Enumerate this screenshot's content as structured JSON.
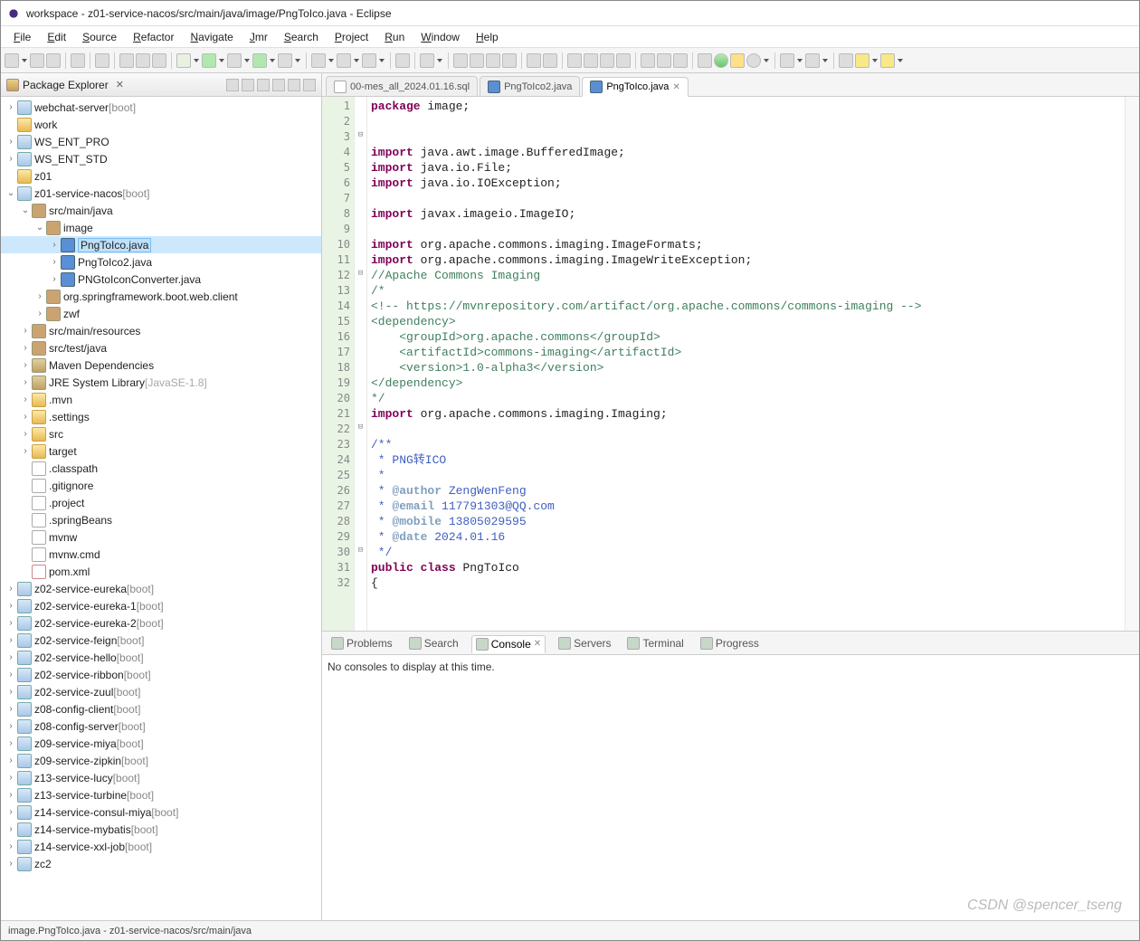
{
  "window": {
    "title": "workspace - z01-service-nacos/src/main/java/image/PngToIco.java - Eclipse"
  },
  "menu": [
    "File",
    "Edit",
    "Source",
    "Refactor",
    "Navigate",
    "Jmr",
    "Search",
    "Project",
    "Run",
    "Window",
    "Help"
  ],
  "package_explorer": {
    "title": "Package Explorer",
    "tree": [
      {
        "d": 1,
        "t": ">",
        "ic": "proj",
        "l": "webchat-server",
        "suf": "[boot]"
      },
      {
        "d": 1,
        "t": "",
        "ic": "folder",
        "l": "work"
      },
      {
        "d": 1,
        "t": ">",
        "ic": "proj",
        "l": "WS_ENT_PRO"
      },
      {
        "d": 1,
        "t": ">",
        "ic": "proj",
        "l": "WS_ENT_STD"
      },
      {
        "d": 1,
        "t": "",
        "ic": "folder",
        "l": "z01"
      },
      {
        "d": 1,
        "t": "v",
        "ic": "proj",
        "l": "z01-service-nacos",
        "suf": "[boot]"
      },
      {
        "d": 2,
        "t": "v",
        "ic": "pkg",
        "l": "src/main/java"
      },
      {
        "d": 3,
        "t": "v",
        "ic": "pkg",
        "l": "image"
      },
      {
        "d": 4,
        "t": ">",
        "ic": "java",
        "l": "PngToIco.java",
        "sel": true
      },
      {
        "d": 4,
        "t": ">",
        "ic": "java",
        "l": "PngToIco2.java"
      },
      {
        "d": 4,
        "t": ">",
        "ic": "java",
        "l": "PNGtoIconConverter.java"
      },
      {
        "d": 3,
        "t": ">",
        "ic": "pkg",
        "l": "org.springframework.boot.web.client"
      },
      {
        "d": 3,
        "t": ">",
        "ic": "pkg",
        "l": "zwf"
      },
      {
        "d": 2,
        "t": ">",
        "ic": "pkg",
        "l": "src/main/resources"
      },
      {
        "d": 2,
        "t": ">",
        "ic": "pkg",
        "l": "src/test/java"
      },
      {
        "d": 2,
        "t": ">",
        "ic": "jar",
        "l": "Maven Dependencies"
      },
      {
        "d": 2,
        "t": ">",
        "ic": "jar",
        "l": "JRE System Library",
        "suf": "[JavaSE-1.8]",
        "jre": true
      },
      {
        "d": 2,
        "t": ">",
        "ic": "folder",
        "l": ".mvn"
      },
      {
        "d": 2,
        "t": ">",
        "ic": "folder",
        "l": ".settings"
      },
      {
        "d": 2,
        "t": ">",
        "ic": "folder",
        "l": "src"
      },
      {
        "d": 2,
        "t": ">",
        "ic": "folder",
        "l": "target"
      },
      {
        "d": 2,
        "t": "",
        "ic": "file",
        "l": ".classpath"
      },
      {
        "d": 2,
        "t": "",
        "ic": "file",
        "l": ".gitignore"
      },
      {
        "d": 2,
        "t": "",
        "ic": "file",
        "l": ".project"
      },
      {
        "d": 2,
        "t": "",
        "ic": "file",
        "l": ".springBeans"
      },
      {
        "d": 2,
        "t": "",
        "ic": "file",
        "l": "mvnw"
      },
      {
        "d": 2,
        "t": "",
        "ic": "file",
        "l": "mvnw.cmd"
      },
      {
        "d": 2,
        "t": "",
        "ic": "xml",
        "l": "pom.xml"
      },
      {
        "d": 1,
        "t": ">",
        "ic": "proj",
        "l": "z02-service-eureka",
        "suf": "[boot]"
      },
      {
        "d": 1,
        "t": ">",
        "ic": "proj",
        "l": "z02-service-eureka-1",
        "suf": "[boot]"
      },
      {
        "d": 1,
        "t": ">",
        "ic": "proj",
        "l": "z02-service-eureka-2",
        "suf": "[boot]"
      },
      {
        "d": 1,
        "t": ">",
        "ic": "proj",
        "l": "z02-service-feign",
        "suf": "[boot]"
      },
      {
        "d": 1,
        "t": ">",
        "ic": "proj",
        "l": "z02-service-hello",
        "suf": "[boot]"
      },
      {
        "d": 1,
        "t": ">",
        "ic": "proj",
        "l": "z02-service-ribbon",
        "suf": "[boot]"
      },
      {
        "d": 1,
        "t": ">",
        "ic": "proj",
        "l": "z02-service-zuul",
        "suf": "[boot]"
      },
      {
        "d": 1,
        "t": ">",
        "ic": "proj",
        "l": "z08-config-client",
        "suf": "[boot]"
      },
      {
        "d": 1,
        "t": ">",
        "ic": "proj",
        "l": "z08-config-server",
        "suf": "[boot]"
      },
      {
        "d": 1,
        "t": ">",
        "ic": "proj",
        "l": "z09-service-miya",
        "suf": "[boot]"
      },
      {
        "d": 1,
        "t": ">",
        "ic": "proj",
        "l": "z09-service-zipkin",
        "suf": "[boot]"
      },
      {
        "d": 1,
        "t": ">",
        "ic": "proj",
        "l": "z13-service-lucy",
        "suf": "[boot]"
      },
      {
        "d": 1,
        "t": ">",
        "ic": "proj",
        "l": "z13-service-turbine",
        "suf": "[boot]"
      },
      {
        "d": 1,
        "t": ">",
        "ic": "proj",
        "l": "z14-service-consul-miya",
        "suf": "[boot]"
      },
      {
        "d": 1,
        "t": ">",
        "ic": "proj",
        "l": "z14-service-mybatis",
        "suf": "[boot]"
      },
      {
        "d": 1,
        "t": ">",
        "ic": "proj",
        "l": "z14-service-xxl-job",
        "suf": "[boot]"
      },
      {
        "d": 1,
        "t": ">",
        "ic": "proj",
        "l": "zc2"
      }
    ]
  },
  "editor": {
    "tabs": [
      {
        "label": "00-mes_all_2024.01.16.sql",
        "active": false,
        "ic": "file"
      },
      {
        "label": "PngToIco2.java",
        "active": false,
        "ic": "java"
      },
      {
        "label": "PngToIco.java",
        "active": true,
        "ic": "java"
      }
    ],
    "lines": [
      {
        "n": 1,
        "t": "code",
        "c": "package image;"
      },
      {
        "n": 2,
        "t": "blank",
        "c": ""
      },
      {
        "n": 3,
        "t": "blank",
        "c": ""
      },
      {
        "n": 4,
        "t": "code",
        "c": "import java.awt.image.BufferedImage;"
      },
      {
        "n": 5,
        "t": "code",
        "c": "import java.io.File;"
      },
      {
        "n": 6,
        "t": "code",
        "c": "import java.io.IOException;"
      },
      {
        "n": 7,
        "t": "blank",
        "c": ""
      },
      {
        "n": 8,
        "t": "code",
        "c": "import javax.imageio.ImageIO;"
      },
      {
        "n": 9,
        "t": "blank",
        "c": ""
      },
      {
        "n": 10,
        "t": "code",
        "c": "import org.apache.commons.imaging.ImageFormats;"
      },
      {
        "n": 11,
        "t": "code",
        "c": "import org.apache.commons.imaging.ImageWriteException;"
      },
      {
        "n": 12,
        "t": "com",
        "c": "//Apache Commons Imaging"
      },
      {
        "n": 13,
        "t": "com",
        "c": "/*"
      },
      {
        "n": 14,
        "t": "com",
        "c": "<!-- https://mvnrepository.com/artifact/org.apache.commons/commons-imaging -->"
      },
      {
        "n": 15,
        "t": "com",
        "c": "<dependency>"
      },
      {
        "n": 16,
        "t": "com",
        "c": "    <groupId>org.apache.commons</groupId>"
      },
      {
        "n": 17,
        "t": "com",
        "c": "    <artifactId>commons-imaging</artifactId>"
      },
      {
        "n": 18,
        "t": "com",
        "c": "    <version>1.0-alpha3</version>"
      },
      {
        "n": 19,
        "t": "com",
        "c": "</dependency>"
      },
      {
        "n": 20,
        "t": "com",
        "c": "*/"
      },
      {
        "n": 21,
        "t": "code",
        "c": "import org.apache.commons.imaging.Imaging;"
      },
      {
        "n": 22,
        "t": "blank",
        "c": ""
      },
      {
        "n": 23,
        "t": "doc",
        "c": "/**",
        "sel": true
      },
      {
        "n": 24,
        "t": "doc",
        "c": " * PNG转ICO",
        "sel": true
      },
      {
        "n": 25,
        "t": "doc",
        "c": " * ",
        "sel": true
      },
      {
        "n": 26,
        "t": "doc-a",
        "c": " * @author ZengWenFeng",
        "sel": true
      },
      {
        "n": 27,
        "t": "doc-a",
        "c": " * @email 117791303@QQ.com",
        "sel": true
      },
      {
        "n": 28,
        "t": "doc-a",
        "c": " * @mobile 13805029595",
        "sel": true
      },
      {
        "n": 29,
        "t": "doc-a",
        "c": " * @date 2024.01.16",
        "sel": true
      },
      {
        "n": 30,
        "t": "doc",
        "c": " */",
        "sel": true
      },
      {
        "n": 31,
        "t": "code",
        "c": "public class PngToIco",
        "sel": true
      },
      {
        "n": 32,
        "t": "code",
        "c": "{",
        "sel": true
      }
    ]
  },
  "bottom": {
    "tabs": [
      "Problems",
      "Search",
      "Console",
      "Servers",
      "Terminal",
      "Progress"
    ],
    "active": "Console",
    "body": "No consoles to display at this time."
  },
  "status": "image.PngToIco.java - z01-service-nacos/src/main/java",
  "watermark": "CSDN @spencer_tseng"
}
